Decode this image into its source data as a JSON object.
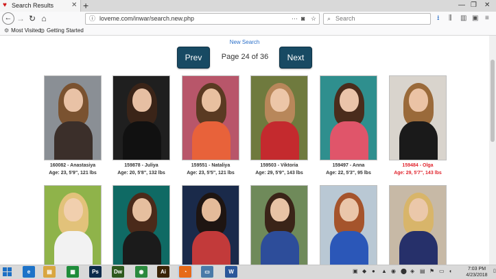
{
  "browser": {
    "tab_title": "Search Results",
    "tab_close": "✕",
    "new_tab": "+",
    "url": "loveme.com/inwar/search.new.php",
    "search_placeholder": "Search",
    "bookmarks": [
      "Most Visited",
      "Getting Started"
    ]
  },
  "page": {
    "new_search": "New Search",
    "prev_label": "Prev",
    "next_label": "Next",
    "page_text": "Page 24 of 36"
  },
  "profiles": [
    {
      "name": "160082 - Anastasiya",
      "info": "Age: 23, 5'9\", 121 lbs",
      "highlight": false,
      "skin": "#e9c2a6",
      "hair": "#7a5230",
      "top": "#3b2f2a",
      "bg": "#8a8f95"
    },
    {
      "name": "159878 - Juliya",
      "info": "Age: 20, 5'8\", 132 lbs",
      "highlight": false,
      "skin": "#e6bfa3",
      "hair": "#3a2418",
      "top": "#111111",
      "bg": "#1f1f1f"
    },
    {
      "name": "159551 - Nataliya",
      "info": "Age: 23, 5'5\", 121 lbs",
      "highlight": false,
      "skin": "#e8c0a0",
      "hair": "#5a3a22",
      "top": "#e8623a",
      "bg": "#b8566a"
    },
    {
      "name": "159503 - Viktoria",
      "info": "Age: 29, 5'9\", 143 lbs",
      "highlight": false,
      "skin": "#ecc6a8",
      "hair": "#b8875a",
      "top": "#c42a2e",
      "bg": "#6f7a3e"
    },
    {
      "name": "159497 - Anna",
      "info": "Age: 22, 5'3\", 95 lbs",
      "highlight": false,
      "skin": "#eac4aa",
      "hair": "#4a2c1c",
      "top": "#e0556a",
      "bg": "#2f8f8e"
    },
    {
      "name": "159484 - Olga",
      "info": "Age: 29, 5'7\", 143 lbs",
      "highlight": true,
      "skin": "#ebc3a5",
      "hair": "#9a6a3a",
      "top": "#1a1a1a",
      "bg": "#d9d4cd"
    },
    {
      "name": "",
      "info": "",
      "highlight": false,
      "skin": "#f1cfae",
      "hair": "#e2c27a",
      "top": "#f2f2f2",
      "bg": "#8fb34a"
    },
    {
      "name": "",
      "info": "",
      "highlight": false,
      "skin": "#e6bf9f",
      "hair": "#4a2a1a",
      "top": "#1b1b1b",
      "bg": "#0f6a64"
    },
    {
      "name": "",
      "info": "",
      "highlight": false,
      "skin": "#e4bb9a",
      "hair": "#1e1512",
      "top": "#c23a3a",
      "bg": "#1a2a4a"
    },
    {
      "name": "",
      "info": "",
      "highlight": false,
      "skin": "#e8c3a5",
      "hair": "#3a2418",
      "top": "#2d4d9a",
      "bg": "#6f8a5a"
    },
    {
      "name": "",
      "info": "",
      "highlight": false,
      "skin": "#eac6aa",
      "hair": "#a5542c",
      "top": "#2b57b8",
      "bg": "#b9c8d4"
    },
    {
      "name": "",
      "info": "",
      "highlight": false,
      "skin": "#ebc8aa",
      "hair": "#d8b56a",
      "top": "#26306a",
      "bg": "#c7b9a6"
    }
  ],
  "taskbar": {
    "apps": [
      {
        "label": "e",
        "color": "#1e73c8"
      },
      {
        "label": "▤",
        "color": "#d9a640"
      },
      {
        "label": "▦",
        "color": "#1e8c3a"
      },
      {
        "label": "Ps",
        "color": "#0d2a4a"
      },
      {
        "label": "Dw",
        "color": "#2f5a1e"
      },
      {
        "label": "◉",
        "color": "#2b8a3e"
      },
      {
        "label": "Ai",
        "color": "#3a2306"
      },
      {
        "label": "◔",
        "color": "#e66a1a"
      },
      {
        "label": "▭",
        "color": "#4a7aa8"
      },
      {
        "label": "W",
        "color": "#2b579a"
      }
    ],
    "time": "7:03 PM",
    "date": "4/23/2018"
  }
}
